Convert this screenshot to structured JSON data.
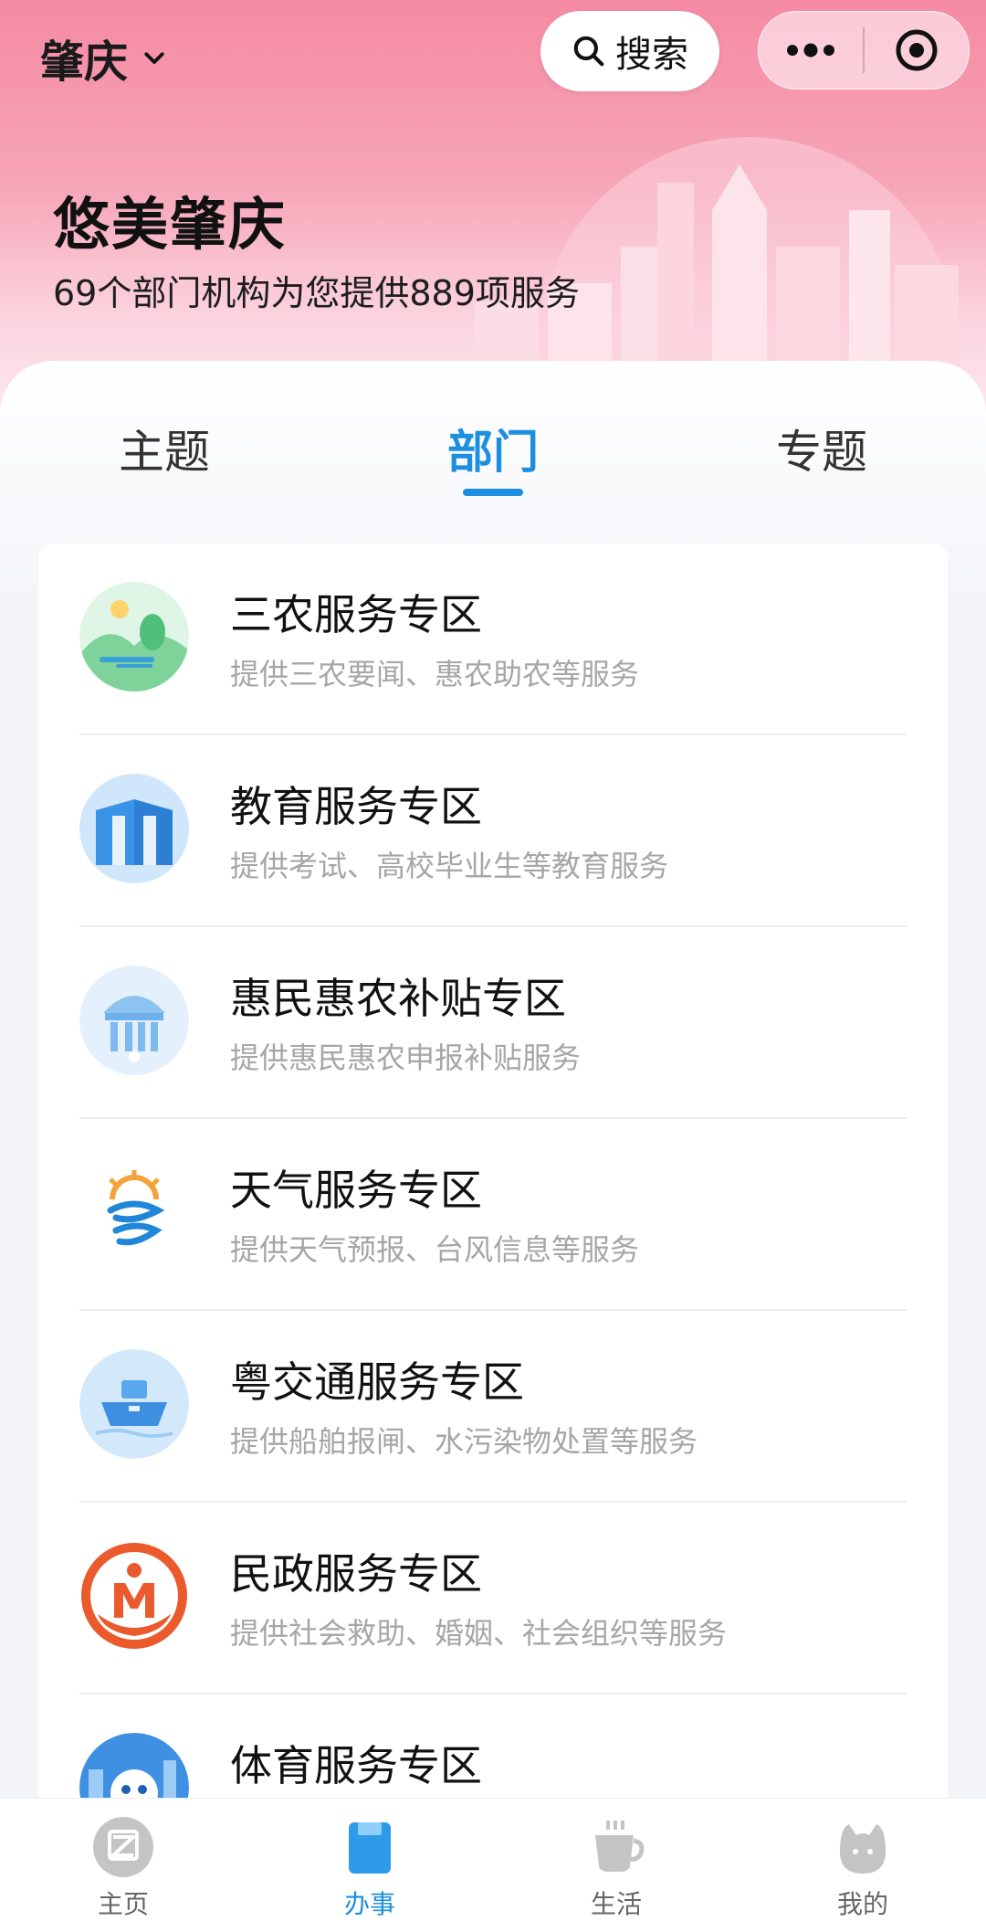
{
  "header": {
    "city": "肇庆",
    "search_label": "搜索",
    "title": "悠美肇庆",
    "subtitle": "69个部门机构为您提供889项服务"
  },
  "tabs": [
    {
      "label": "主题",
      "active": false
    },
    {
      "label": "部门",
      "active": true
    },
    {
      "label": "专题",
      "active": false
    }
  ],
  "services": [
    {
      "name": "三农服务专区",
      "desc": "提供三农要闻、惠农助农等服务",
      "icon": "landscape-icon"
    },
    {
      "name": "教育服务专区",
      "desc": "提供考试、高校毕业生等教育服务",
      "icon": "books-icon"
    },
    {
      "name": "惠民惠农补贴专区",
      "desc": "提供惠民惠农申报补贴服务",
      "icon": "government-building-icon"
    },
    {
      "name": "天气服务专区",
      "desc": "提供天气预报、台风信息等服务",
      "icon": "weather-icon"
    },
    {
      "name": "粤交通服务专区",
      "desc": "提供船舶报闸、水污染物处置等服务",
      "icon": "ship-icon"
    },
    {
      "name": "民政服务专区",
      "desc": "提供社会救助、婚姻、社会组织等服务",
      "icon": "civil-affairs-logo-icon"
    },
    {
      "name": "体育服务专区",
      "desc": "",
      "icon": "sports-mascot-icon"
    }
  ],
  "bottom_nav": [
    {
      "label": "主页",
      "icon": "home-icon",
      "active": false
    },
    {
      "label": "办事",
      "icon": "affairs-icon",
      "active": true
    },
    {
      "label": "生活",
      "icon": "cup-icon",
      "active": false
    },
    {
      "label": "我的",
      "icon": "profile-icon",
      "active": false
    }
  ],
  "colors": {
    "accent": "#1e8fe0",
    "header_pink": "#f58aa3"
  }
}
